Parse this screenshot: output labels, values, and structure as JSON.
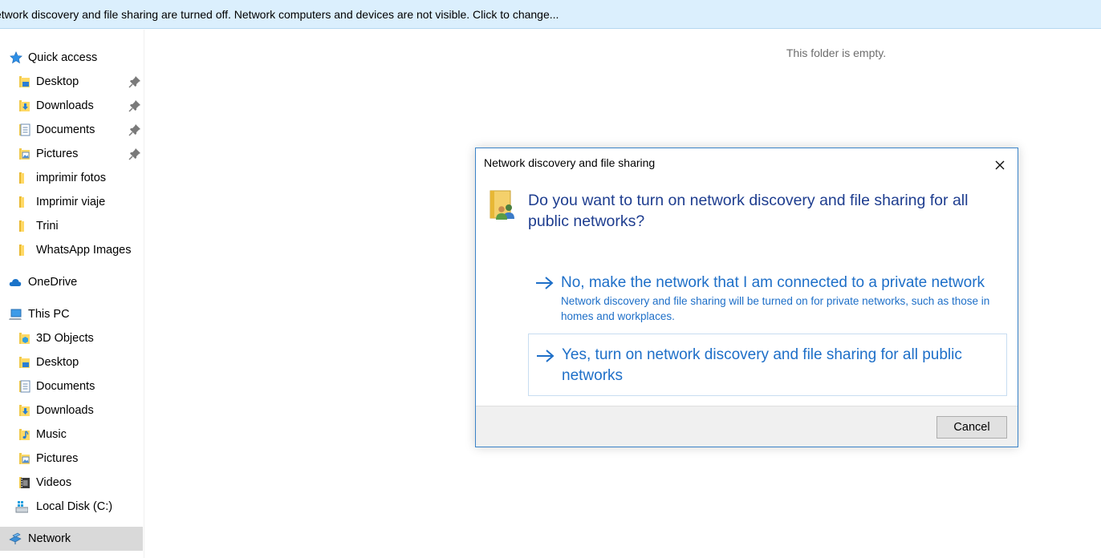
{
  "infobar": {
    "text": "etwork discovery and file sharing are turned off. Network computers and devices are not visible. Click to change..."
  },
  "nav": {
    "quick_access": {
      "label": "Quick access",
      "items": [
        {
          "label": "Desktop",
          "pinned": true
        },
        {
          "label": "Downloads",
          "pinned": true
        },
        {
          "label": "Documents",
          "pinned": true
        },
        {
          "label": "Pictures",
          "pinned": true
        },
        {
          "label": "imprimir fotos",
          "pinned": false
        },
        {
          "label": "Imprimir viaje",
          "pinned": false
        },
        {
          "label": "Trini",
          "pinned": false
        },
        {
          "label": "WhatsApp Images",
          "pinned": false
        }
      ]
    },
    "onedrive": {
      "label": "OneDrive"
    },
    "this_pc": {
      "label": "This PC",
      "items": [
        {
          "label": "3D Objects"
        },
        {
          "label": "Desktop"
        },
        {
          "label": "Documents"
        },
        {
          "label": "Downloads"
        },
        {
          "label": "Music"
        },
        {
          "label": "Pictures"
        },
        {
          "label": "Videos"
        },
        {
          "label": "Local Disk (C:)"
        }
      ]
    },
    "network": {
      "label": "Network",
      "selected": true
    }
  },
  "content": {
    "empty_message": "This folder is empty."
  },
  "dialog": {
    "title": "Network discovery and file sharing",
    "question": "Do you want to turn on network discovery and file sharing for all public networks?",
    "option_private": {
      "title": "No, make the network that I am connected to a private network",
      "description": "Network discovery and file sharing will be turned on for private networks, such as those in homes and workplaces."
    },
    "option_public": {
      "title": "Yes, turn on network discovery and file sharing for all public networks"
    },
    "cancel_label": "Cancel"
  },
  "icons": {
    "quick_access": "star-icon",
    "folder": "folder-icon",
    "pin": "pin-icon",
    "onedrive": "cloud-icon",
    "this_pc": "computer-icon",
    "network": "network-icon",
    "close": "close-icon",
    "arrow": "arrow-right-icon"
  },
  "colors": {
    "infobar_bg": "#dbeffd",
    "link_blue": "#1e6fc8",
    "heading_blue": "#1e3d8f",
    "dialog_border": "#3b83c8",
    "selected_bg": "#d9d9d9"
  }
}
